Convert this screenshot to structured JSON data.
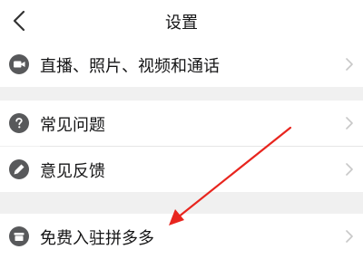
{
  "header": {
    "title": "设置",
    "back_icon": "chevron-left-icon"
  },
  "items": [
    {
      "label": "直播、照片、视频和通话",
      "icon": "video-camera-icon"
    },
    {
      "label": "常见问题",
      "icon": "question-icon"
    },
    {
      "label": "意见反馈",
      "icon": "edit-pencil-icon"
    },
    {
      "label": "免费入驻拼多多",
      "icon": "store-icon"
    }
  ],
  "colors": {
    "background": "#f0f0f0",
    "row": "#ffffff",
    "icon": "#58595b",
    "chevron": "#c8c8c8",
    "annotation_arrow": "#e8251e"
  }
}
